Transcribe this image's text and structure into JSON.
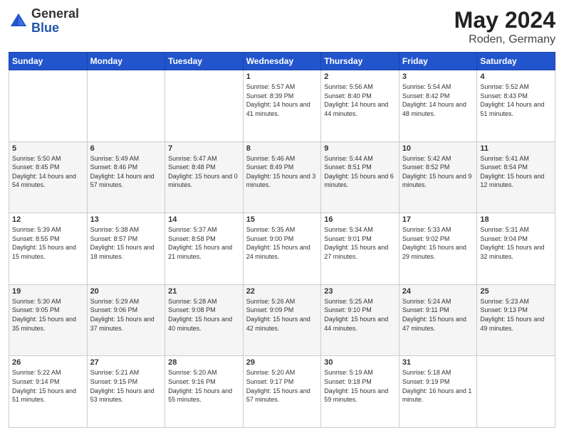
{
  "header": {
    "logo_general": "General",
    "logo_blue": "Blue",
    "month_title": "May 2024",
    "location": "Roden, Germany"
  },
  "days_of_week": [
    "Sunday",
    "Monday",
    "Tuesday",
    "Wednesday",
    "Thursday",
    "Friday",
    "Saturday"
  ],
  "weeks": [
    [
      {
        "day": "",
        "sunrise": "",
        "sunset": "",
        "daylight": ""
      },
      {
        "day": "",
        "sunrise": "",
        "sunset": "",
        "daylight": ""
      },
      {
        "day": "",
        "sunrise": "",
        "sunset": "",
        "daylight": ""
      },
      {
        "day": "1",
        "sunrise": "Sunrise: 5:57 AM",
        "sunset": "Sunset: 8:39 PM",
        "daylight": "Daylight: 14 hours and 41 minutes."
      },
      {
        "day": "2",
        "sunrise": "Sunrise: 5:56 AM",
        "sunset": "Sunset: 8:40 PM",
        "daylight": "Daylight: 14 hours and 44 minutes."
      },
      {
        "day": "3",
        "sunrise": "Sunrise: 5:54 AM",
        "sunset": "Sunset: 8:42 PM",
        "daylight": "Daylight: 14 hours and 48 minutes."
      },
      {
        "day": "4",
        "sunrise": "Sunrise: 5:52 AM",
        "sunset": "Sunset: 8:43 PM",
        "daylight": "Daylight: 14 hours and 51 minutes."
      }
    ],
    [
      {
        "day": "5",
        "sunrise": "Sunrise: 5:50 AM",
        "sunset": "Sunset: 8:45 PM",
        "daylight": "Daylight: 14 hours and 54 minutes."
      },
      {
        "day": "6",
        "sunrise": "Sunrise: 5:49 AM",
        "sunset": "Sunset: 8:46 PM",
        "daylight": "Daylight: 14 hours and 57 minutes."
      },
      {
        "day": "7",
        "sunrise": "Sunrise: 5:47 AM",
        "sunset": "Sunset: 8:48 PM",
        "daylight": "Daylight: 15 hours and 0 minutes."
      },
      {
        "day": "8",
        "sunrise": "Sunrise: 5:46 AM",
        "sunset": "Sunset: 8:49 PM",
        "daylight": "Daylight: 15 hours and 3 minutes."
      },
      {
        "day": "9",
        "sunrise": "Sunrise: 5:44 AM",
        "sunset": "Sunset: 8:51 PM",
        "daylight": "Daylight: 15 hours and 6 minutes."
      },
      {
        "day": "10",
        "sunrise": "Sunrise: 5:42 AM",
        "sunset": "Sunset: 8:52 PM",
        "daylight": "Daylight: 15 hours and 9 minutes."
      },
      {
        "day": "11",
        "sunrise": "Sunrise: 5:41 AM",
        "sunset": "Sunset: 8:54 PM",
        "daylight": "Daylight: 15 hours and 12 minutes."
      }
    ],
    [
      {
        "day": "12",
        "sunrise": "Sunrise: 5:39 AM",
        "sunset": "Sunset: 8:55 PM",
        "daylight": "Daylight: 15 hours and 15 minutes."
      },
      {
        "day": "13",
        "sunrise": "Sunrise: 5:38 AM",
        "sunset": "Sunset: 8:57 PM",
        "daylight": "Daylight: 15 hours and 18 minutes."
      },
      {
        "day": "14",
        "sunrise": "Sunrise: 5:37 AM",
        "sunset": "Sunset: 8:58 PM",
        "daylight": "Daylight: 15 hours and 21 minutes."
      },
      {
        "day": "15",
        "sunrise": "Sunrise: 5:35 AM",
        "sunset": "Sunset: 9:00 PM",
        "daylight": "Daylight: 15 hours and 24 minutes."
      },
      {
        "day": "16",
        "sunrise": "Sunrise: 5:34 AM",
        "sunset": "Sunset: 9:01 PM",
        "daylight": "Daylight: 15 hours and 27 minutes."
      },
      {
        "day": "17",
        "sunrise": "Sunrise: 5:33 AM",
        "sunset": "Sunset: 9:02 PM",
        "daylight": "Daylight: 15 hours and 29 minutes."
      },
      {
        "day": "18",
        "sunrise": "Sunrise: 5:31 AM",
        "sunset": "Sunset: 9:04 PM",
        "daylight": "Daylight: 15 hours and 32 minutes."
      }
    ],
    [
      {
        "day": "19",
        "sunrise": "Sunrise: 5:30 AM",
        "sunset": "Sunset: 9:05 PM",
        "daylight": "Daylight: 15 hours and 35 minutes."
      },
      {
        "day": "20",
        "sunrise": "Sunrise: 5:29 AM",
        "sunset": "Sunset: 9:06 PM",
        "daylight": "Daylight: 15 hours and 37 minutes."
      },
      {
        "day": "21",
        "sunrise": "Sunrise: 5:28 AM",
        "sunset": "Sunset: 9:08 PM",
        "daylight": "Daylight: 15 hours and 40 minutes."
      },
      {
        "day": "22",
        "sunrise": "Sunrise: 5:26 AM",
        "sunset": "Sunset: 9:09 PM",
        "daylight": "Daylight: 15 hours and 42 minutes."
      },
      {
        "day": "23",
        "sunrise": "Sunrise: 5:25 AM",
        "sunset": "Sunset: 9:10 PM",
        "daylight": "Daylight: 15 hours and 44 minutes."
      },
      {
        "day": "24",
        "sunrise": "Sunrise: 5:24 AM",
        "sunset": "Sunset: 9:11 PM",
        "daylight": "Daylight: 15 hours and 47 minutes."
      },
      {
        "day": "25",
        "sunrise": "Sunrise: 5:23 AM",
        "sunset": "Sunset: 9:13 PM",
        "daylight": "Daylight: 15 hours and 49 minutes."
      }
    ],
    [
      {
        "day": "26",
        "sunrise": "Sunrise: 5:22 AM",
        "sunset": "Sunset: 9:14 PM",
        "daylight": "Daylight: 15 hours and 51 minutes."
      },
      {
        "day": "27",
        "sunrise": "Sunrise: 5:21 AM",
        "sunset": "Sunset: 9:15 PM",
        "daylight": "Daylight: 15 hours and 53 minutes."
      },
      {
        "day": "28",
        "sunrise": "Sunrise: 5:20 AM",
        "sunset": "Sunset: 9:16 PM",
        "daylight": "Daylight: 15 hours and 55 minutes."
      },
      {
        "day": "29",
        "sunrise": "Sunrise: 5:20 AM",
        "sunset": "Sunset: 9:17 PM",
        "daylight": "Daylight: 15 hours and 57 minutes."
      },
      {
        "day": "30",
        "sunrise": "Sunrise: 5:19 AM",
        "sunset": "Sunset: 9:18 PM",
        "daylight": "Daylight: 15 hours and 59 minutes."
      },
      {
        "day": "31",
        "sunrise": "Sunrise: 5:18 AM",
        "sunset": "Sunset: 9:19 PM",
        "daylight": "Daylight: 16 hours and 1 minute."
      },
      {
        "day": "",
        "sunrise": "",
        "sunset": "",
        "daylight": ""
      }
    ]
  ]
}
